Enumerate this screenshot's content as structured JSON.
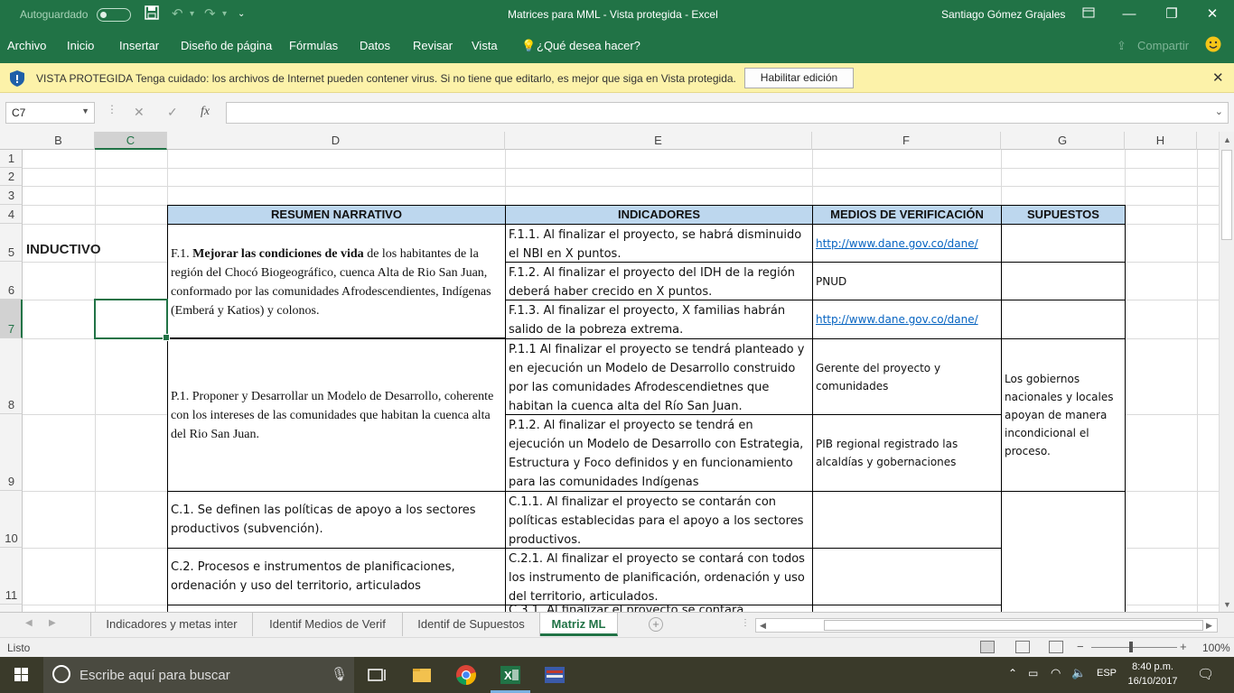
{
  "titlebar": {
    "autosave_label": "Autoguardado",
    "title": "Matrices para MML  -  Vista protegida  -  Excel",
    "user": "Santiago Gómez Grajales"
  },
  "menu": {
    "items": [
      "Archivo",
      "Inicio",
      "Insertar",
      "Diseño de página",
      "Fórmulas",
      "Datos",
      "Revisar",
      "Vista"
    ],
    "tell_me": "¿Qué desea hacer?",
    "share": "Compartir"
  },
  "banner": {
    "title": "VISTA PROTEGIDA",
    "message": "Tenga cuidado: los archivos de Internet pueden contener virus. Si no tiene que editarlo, es mejor que siga en Vista protegida.",
    "enable_button": "Habilitar edición"
  },
  "formula_bar": {
    "name_box": "C7",
    "fx": "fx",
    "value": ""
  },
  "columns": [
    "B",
    "C",
    "D",
    "E",
    "F",
    "G",
    "H"
  ],
  "rows": [
    "1",
    "2",
    "3",
    "4",
    "5",
    "6",
    "7",
    "8",
    "9",
    "10",
    "11"
  ],
  "sheet": {
    "headers": {
      "resumen": "RESUMEN NARRATIVO",
      "indicadores": "INDICADORES",
      "medios": "MEDIOS DE VERIFICACIÓN",
      "supuestos": "SUPUESTOS"
    },
    "b5": "INDUCTIVO",
    "fin": {
      "prefix": "F.1. ",
      "bold": "Mejorar las condiciones de vida",
      "rest": " de los habitantes de la región del Chocó Biogeográfico, cuenca Alta de Rio San Juan, conformado por las comunidades Afrodescendientes, Indígenas (Emberá y Katios) y colonos."
    },
    "e5": "F.1.1. Al finalizar el proyecto, se habrá disminuido el NBI en X puntos.",
    "e6": "F.1.2. Al finalizar el proyecto del IDH de la región deberá haber crecido en X puntos.",
    "e7": "F.1.3. Al finalizar el proyecto, X familias habrán salido de la pobreza extrema.",
    "f5": "http://www.dane.gov.co/dane/",
    "f6": "PNUD",
    "f7": "http://www.dane.gov.co/dane/",
    "d8": "P.1. Proponer y Desarrollar un Modelo de Desarrollo, coherente con los intereses de las comunidades que habitan la cuenca alta del Rio San Juan.",
    "e8": "P.1.1 Al finalizar el proyecto se tendrá planteado y en ejecución un Modelo de Desarrollo construido por las comunidades Afrodescendietnes que habitan la cuenca alta del Río San Juan.",
    "e9": "P.1.2. Al finalizar el proyecto se tendrá en ejecución un Modelo de Desarrollo con Estrategia, Estructura y Foco definidos y en funcionamiento para las comunidades Indígenas",
    "f8": "Gerente del proyecto y comunidades",
    "f9": "PIB regional registrado las alcaldías y gobernaciones",
    "g8": "Los gobiernos nacionales y locales apoyan de manera incondicional el proceso.",
    "d10": "C.1. Se definen las políticas de apoyo a los sectores productivos (subvención).",
    "e10": "C.1.1. Al finalizar el proyecto se contarán con políticas establecidas para el apoyo a los sectores productivos.",
    "d11": "C.2. Procesos e instrumentos de planificaciones, ordenación y uso del territorio, articulados",
    "e11": "C.2.1. Al finalizar el proyecto se contará con todos los instrumento de planificación, ordenación y uso del territorio, articulados.",
    "e12_partial": "C.3.1. Al finalizar el proyecto se contará"
  },
  "sheet_tabs": [
    "Indicadores y metas inter",
    "Identif Medios de Verif",
    "Identif de Supuestos",
    "Matriz ML"
  ],
  "active_tab": "Matriz ML",
  "status": {
    "text": "Listo",
    "zoom": "100%"
  },
  "taskbar": {
    "search_placeholder": "Escribe aquí para buscar",
    "lang": "ESP",
    "time": "8:40 p.m.",
    "date": "16/10/2017"
  },
  "colors": {
    "excel_green": "#217346",
    "banner_yellow": "#fcf2a9",
    "header_fill": "#bdd7ee",
    "link": "#0563c1"
  }
}
